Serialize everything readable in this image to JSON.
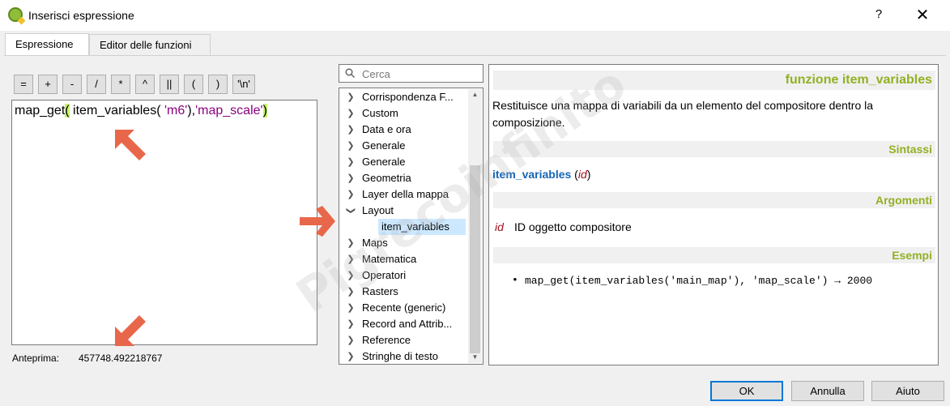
{
  "window": {
    "title": "Inserisci espressione",
    "help_label": "?",
    "close_label": "✕"
  },
  "tabs": [
    {
      "label": "Espressione"
    },
    {
      "label": "Editor delle funzioni"
    }
  ],
  "operators": [
    "=",
    "+",
    "-",
    "/",
    "*",
    "^",
    "||",
    "(",
    ")",
    "'\\n'"
  ],
  "editor": {
    "code": {
      "p1": "map_get",
      "p2": "(",
      "p3": " item_variables( ",
      "p4": "'m6'",
      "p5": "),",
      "p6": "'map_scale'",
      "p7": ")"
    }
  },
  "preview": {
    "label": "Anteprima:",
    "value": "457748.492218767"
  },
  "search": {
    "placeholder": "Cerca"
  },
  "tree": {
    "items": [
      {
        "label": "Corrispondenza F...",
        "expanded": false
      },
      {
        "label": "Custom",
        "expanded": false
      },
      {
        "label": "Data e ora",
        "expanded": false
      },
      {
        "label": "Generale",
        "expanded": false
      },
      {
        "label": "Generale",
        "expanded": false
      },
      {
        "label": "Geometria",
        "expanded": false
      },
      {
        "label": "Layer della mappa",
        "expanded": false
      },
      {
        "label": "Layout",
        "expanded": true
      },
      {
        "label": "item_variables",
        "child": true,
        "selected": true
      },
      {
        "label": "Maps",
        "expanded": false
      },
      {
        "label": "Matematica",
        "expanded": false
      },
      {
        "label": "Operatori",
        "expanded": false
      },
      {
        "label": "Rasters",
        "expanded": false
      },
      {
        "label": "Recente (generic)",
        "expanded": false
      },
      {
        "label": "Record and Attrib...",
        "expanded": false
      },
      {
        "label": "Reference",
        "expanded": false
      },
      {
        "label": "Stringhe di testo",
        "expanded": false
      }
    ]
  },
  "help": {
    "title": "funzione item_variables",
    "description": "Restituisce una mappa di variabili da un elemento del compositore dentro la composizione.",
    "syntax_header": "Sintassi",
    "syntax_fn": "item_variables",
    "syntax_open": " (",
    "syntax_arg": "id",
    "syntax_close": ")",
    "arguments_header": "Argomenti",
    "argument_name": "id",
    "argument_desc": "ID oggetto compositore",
    "examples_header": "Esempi",
    "example": "map_get(item_variables('main_map'), 'map_scale') → 2000"
  },
  "buttons": {
    "ok": "OK",
    "cancel": "Annulla",
    "help": "Aiuto"
  },
  "watermark": "Pigrecoinfinito",
  "colors": {
    "accent": "#93b023",
    "highlight": "#c8f56a",
    "arrow": "#e8674a",
    "selection": "#cce8ff"
  },
  "icons": {
    "search": "magnifier",
    "app": "qgis-logo"
  }
}
